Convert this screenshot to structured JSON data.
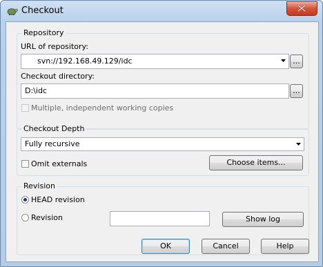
{
  "window": {
    "title": "Checkout"
  },
  "repository": {
    "group_label": "Repository",
    "url_label": "URL of repository:",
    "url_value": "svn://192.168.49.129/idc",
    "browse_label": "...",
    "dir_label": "Checkout directory:",
    "dir_value": "D:\\idc",
    "dir_browse_label": "...",
    "multiple_copies_label": "Multiple, independent working copies"
  },
  "depth": {
    "group_label": "Checkout Depth",
    "selected": "Fully recursive",
    "omit_externals_label": "Omit externals",
    "choose_items_label": "Choose items..."
  },
  "revision": {
    "group_label": "Revision",
    "head_label": "HEAD revision",
    "revision_label": "Revision",
    "revision_value": "",
    "show_log_label": "Show log"
  },
  "buttons": {
    "ok": "OK",
    "cancel": "Cancel",
    "help": "Help"
  }
}
